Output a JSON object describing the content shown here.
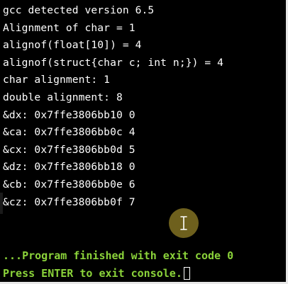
{
  "console": {
    "output_lines": [
      "gcc detected version 6.5",
      "Alignment of char = 1",
      "alignof(float[10]) = 4",
      "alignof(struct{char c; int n;}) = 4",
      "char alignment: 1",
      "double alignment: 8",
      "&dx: 0x7ffe3806bb10 0",
      "&ca: 0x7ffe3806bb0c 4",
      "&cx: 0x7ffe3806bb0d 5",
      "&dz: 0x7ffe3806bb18 0",
      "&cb: 0x7ffe3806bb0e 6",
      "&cz: 0x7ffe3806bb0f 7"
    ],
    "status_finished": "...Program finished with exit code 0",
    "status_prompt": "Press ENTER to exit console.",
    "text_color": "#ffffff",
    "status_color": "#8bd33a",
    "background_color": "#000000"
  },
  "pointer": {
    "icon": "i-beam-text-cursor-icon",
    "highlight_color": "#7a6a20"
  }
}
